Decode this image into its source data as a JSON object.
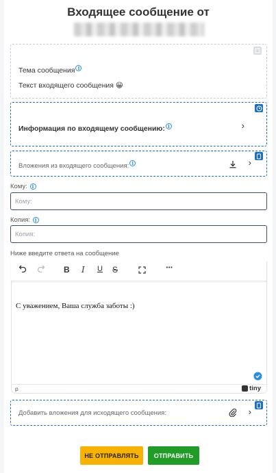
{
  "header": {
    "title": "Входящее сообщение от"
  },
  "message": {
    "subject_label": "Тема сообщения",
    "body_text": "Текст входящего сообщения 😀"
  },
  "incoming_info": {
    "label": "Информация по входящему сообщению:"
  },
  "attachments_in": {
    "label": "Вложения из входящего сообщения:"
  },
  "to": {
    "label": "Кому:",
    "placeholder": "Кому:"
  },
  "cc": {
    "label": "Копия:",
    "placeholder": "Копия:"
  },
  "reply": {
    "label": "Ниже введите ответа на сообщение",
    "body": "С уважением, Ваша служба заботы :)",
    "status_path": "p",
    "brand": "tiny"
  },
  "attachments_out": {
    "label": "Добавить вложения для исходящего сообщения:"
  },
  "buttons": {
    "dont_send": "НЕ ОТПРАВЛЯТЬ",
    "send": "ОТПРАВИТЬ"
  },
  "colors": {
    "accent_blue": "#1e6fc2",
    "input_border": "#3d4a72",
    "dont_send_bg": "#f9b200",
    "send_bg": "#1f9d26"
  },
  "icons": [
    "info-icon",
    "chevron-right-icon",
    "download-icon",
    "paperclip-icon",
    "undo-icon",
    "redo-icon",
    "bold-icon",
    "italic-icon",
    "underline-icon",
    "strikethrough-icon",
    "fullscreen-icon",
    "more-icon",
    "check-circle-icon",
    "tiny-logo-icon"
  ]
}
